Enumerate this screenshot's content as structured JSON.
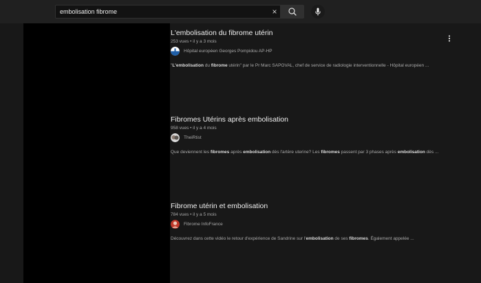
{
  "search": {
    "query": "embolisation fibrome",
    "clear_label": "×"
  },
  "colors": {
    "background": "#181818",
    "topbar": "#202020",
    "left_panel": "#000000",
    "title_text": "#f1f1f1",
    "secondary_text": "#aaaaaa"
  },
  "results": [
    {
      "title": "L'embolisation du fibrome utérin",
      "meta": "253 vues • il y a 3 mois",
      "channel": "Hôpital européen Georges Pompidou AP-HP",
      "avatar_icon": "hospital-logo-icon",
      "desc_parts": [
        {
          "text": "\"",
          "bold": false
        },
        {
          "text": "L'embolisation",
          "bold": true
        },
        {
          "text": " du ",
          "bold": false
        },
        {
          "text": "fibrome",
          "bold": true
        },
        {
          "text": " utérin\" par le Pr Marc SAPOVAL, chef de service de radiologie interventionnelle - Hôpital européen ...",
          "bold": false
        }
      ],
      "has_menu": true
    },
    {
      "title": "Fibromes Utérins après embolisation",
      "meta": "958 vues • il y a 4 mois",
      "channel": "TheiRtist",
      "avatar_icon": "channel-avatar-icon",
      "desc_parts": [
        {
          "text": "Que deviennent les ",
          "bold": false
        },
        {
          "text": "fibromes",
          "bold": true
        },
        {
          "text": " après ",
          "bold": false
        },
        {
          "text": "embolisation",
          "bold": true
        },
        {
          "text": " dès l'artère uterine? Les ",
          "bold": false
        },
        {
          "text": "fibromes",
          "bold": true
        },
        {
          "text": " passent par 3 phases après ",
          "bold": false
        },
        {
          "text": "embolisation",
          "bold": true
        },
        {
          "text": " dès ...",
          "bold": false
        }
      ],
      "has_menu": false
    },
    {
      "title": "Fibrome utérin et embolisation",
      "meta": "784 vues • il y a 5 mois",
      "channel": "Fibrome InfoFrance",
      "avatar_icon": "channel-avatar-icon",
      "desc_parts": [
        {
          "text": "Découvrez dans cette vidéo le retour d'expérience de Sandrine sur l'",
          "bold": false
        },
        {
          "text": "embolisation",
          "bold": true
        },
        {
          "text": " de ses ",
          "bold": false
        },
        {
          "text": "fibromes",
          "bold": true
        },
        {
          "text": ". Également appelée ...",
          "bold": false
        }
      ],
      "has_menu": false
    }
  ]
}
